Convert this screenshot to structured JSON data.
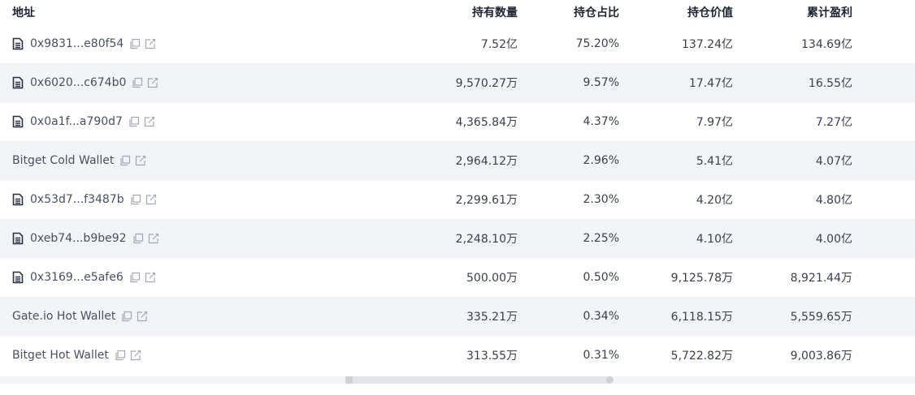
{
  "table": {
    "headers": {
      "address": "地址",
      "quantity": "持有数量",
      "share": "持仓占比",
      "value": "持仓价值",
      "pnl": "累计盈利"
    },
    "rows": [
      {
        "address": "0x9831...e80f54",
        "is_contract": true,
        "quantity": "7.52亿",
        "share": "75.20%",
        "value": "137.24亿",
        "pnl": "134.69亿"
      },
      {
        "address": "0x6020...c674b0",
        "is_contract": true,
        "quantity": "9,570.27万",
        "share": "9.57%",
        "value": "17.47亿",
        "pnl": "16.55亿"
      },
      {
        "address": "0x0a1f...a790d7",
        "is_contract": true,
        "quantity": "4,365.84万",
        "share": "4.37%",
        "value": "7.97亿",
        "pnl": "7.27亿"
      },
      {
        "address": "Bitget Cold Wallet",
        "is_contract": false,
        "quantity": "2,964.12万",
        "share": "2.96%",
        "value": "5.41亿",
        "pnl": "4.07亿"
      },
      {
        "address": "0x53d7...f3487b",
        "is_contract": true,
        "quantity": "2,299.61万",
        "share": "2.30%",
        "value": "4.20亿",
        "pnl": "4.80亿"
      },
      {
        "address": "0xeb74...b9be92",
        "is_contract": true,
        "quantity": "2,248.10万",
        "share": "2.25%",
        "value": "4.10亿",
        "pnl": "4.00亿"
      },
      {
        "address": "0x3169...e5afe6",
        "is_contract": true,
        "quantity": "500.00万",
        "share": "0.50%",
        "value": "9,125.78万",
        "pnl": "8,921.44万"
      },
      {
        "address": "Gate.io Hot Wallet",
        "is_contract": false,
        "quantity": "335.21万",
        "share": "0.34%",
        "value": "6,118.15万",
        "pnl": "5,559.65万"
      },
      {
        "address": "Bitget Hot Wallet",
        "is_contract": false,
        "quantity": "313.55万",
        "share": "0.31%",
        "value": "5,722.82万",
        "pnl": "9,003.86万"
      }
    ]
  },
  "icons": {
    "contract": "document-icon",
    "copy": "copy-icon",
    "edit": "external-edit-icon"
  },
  "colors": {
    "stripe": "#f3f4f8",
    "text": "#3a3f4a",
    "header_text": "#1f2430",
    "icon_gray": "#9aa0aa",
    "doc_icon": "#2b3140"
  }
}
